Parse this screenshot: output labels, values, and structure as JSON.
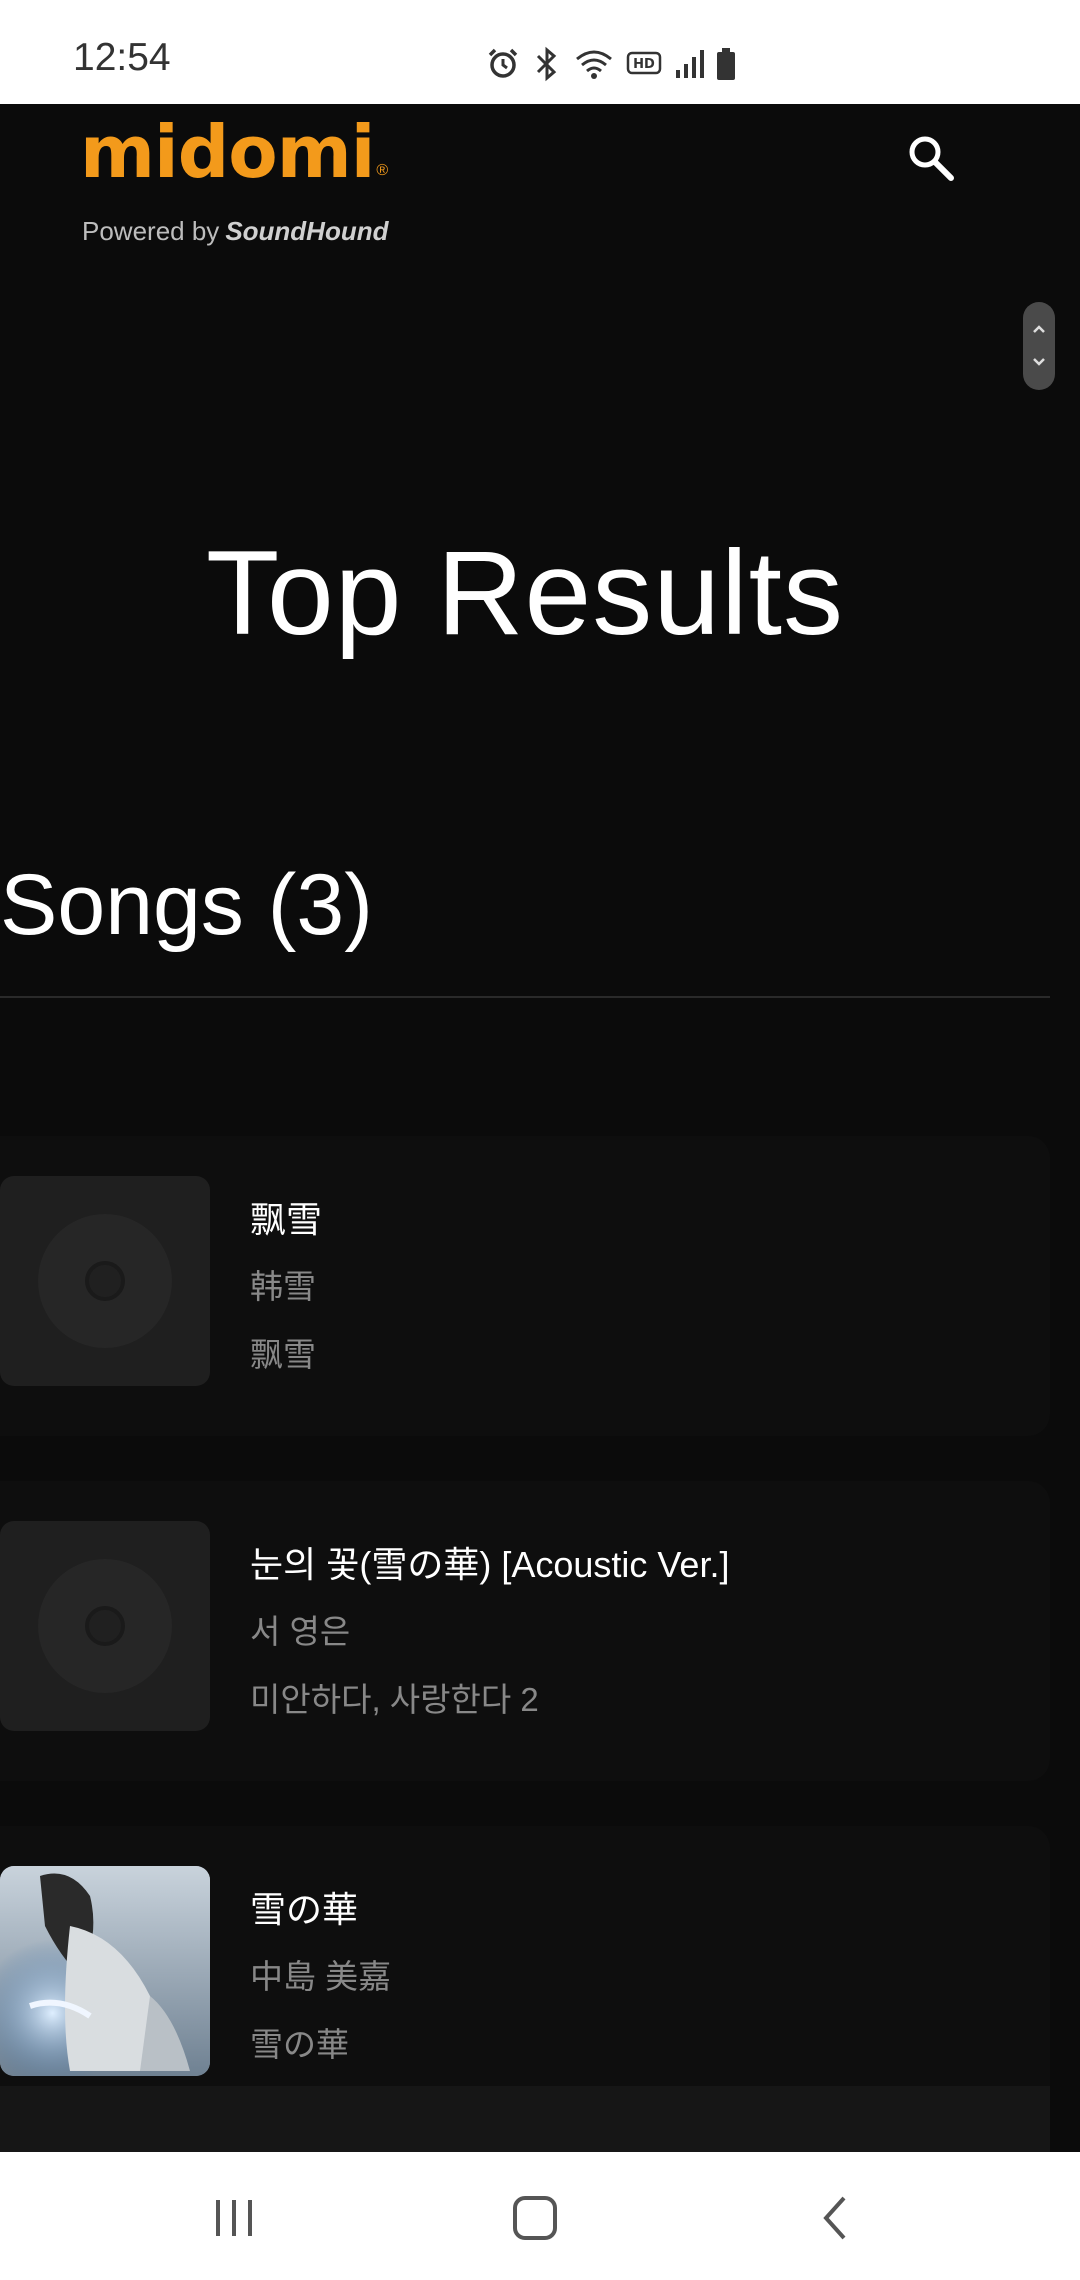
{
  "status_bar": {
    "time": "12:54",
    "icons": [
      "alarm-icon",
      "bluetooth-icon",
      "wifi-icon",
      "hd-icon",
      "signal-icon",
      "battery-icon"
    ]
  },
  "header": {
    "logo_text": "midomi",
    "powered_by": "Powered by",
    "brand": "SoundHound",
    "accent_color": "#f39a1b"
  },
  "main": {
    "page_title": "Top Results",
    "songs_section_title": "Songs (3)",
    "songs": [
      {
        "title": "飘雪",
        "artist": "韩雪",
        "album": "飘雪",
        "artwork": "placeholder-disc"
      },
      {
        "title": "눈의 꽃(雪の華) [Acoustic Ver.]",
        "artist": "서 영은",
        "album": "미안하다, 사랑한다 2",
        "artwork": "placeholder-disc"
      },
      {
        "title": "雪の華",
        "artist": "中島 美嘉",
        "album": "雪の華",
        "artwork": "album-photo"
      }
    ]
  },
  "navigation_bar": {
    "buttons": [
      "recent-apps-icon",
      "home-icon",
      "back-icon"
    ]
  }
}
